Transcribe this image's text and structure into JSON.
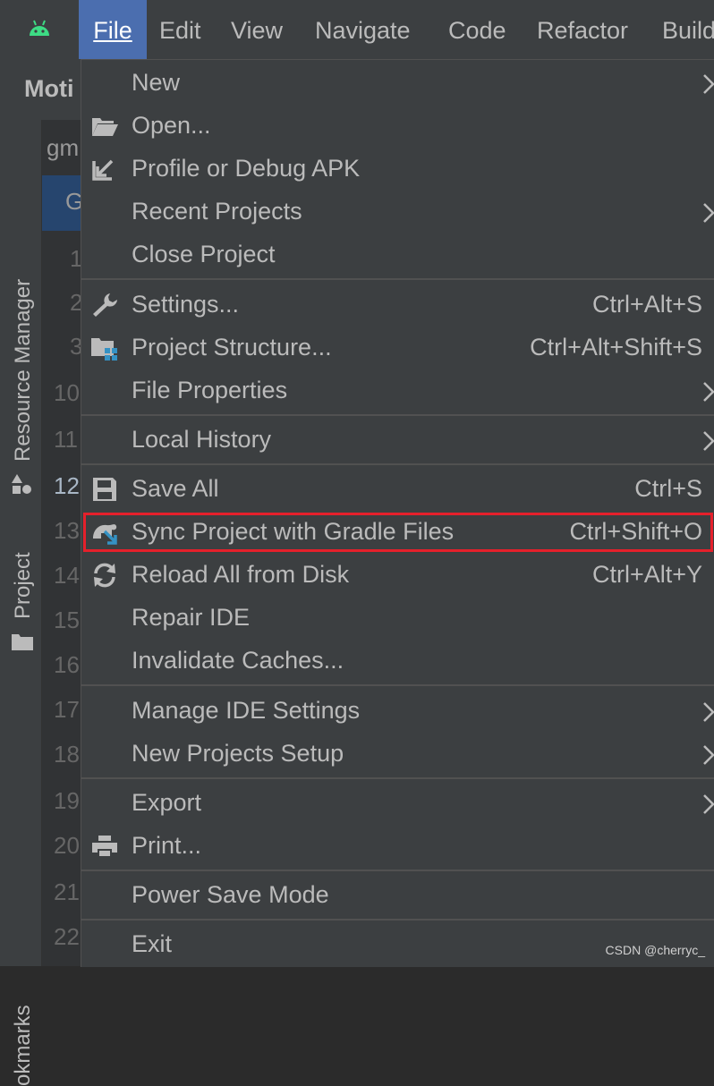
{
  "menubar": {
    "items": [
      "File",
      "Edit",
      "View",
      "Navigate",
      "Code",
      "Refactor",
      "Build"
    ]
  },
  "tool_window": {
    "title": "Moti"
  },
  "editor": {
    "tabs": [
      "gm",
      "G"
    ],
    "line_numbers": [
      "1",
      "2",
      "3",
      "10",
      "11",
      "12",
      "13",
      "14",
      "15",
      "16",
      "17",
      "18",
      "19",
      "20",
      "21",
      "22"
    ]
  },
  "side_tabs": {
    "resource_manager": "Resource Manager",
    "project": "Project",
    "bookmarks": "okmarks"
  },
  "file_menu": {
    "new": "New",
    "open": "Open...",
    "profile_debug_apk": "Profile or Debug APK",
    "recent_projects": "Recent Projects",
    "close_project": "Close Project",
    "settings": "Settings...",
    "settings_shortcut": "Ctrl+Alt+S",
    "project_structure": "Project Structure...",
    "project_structure_shortcut": "Ctrl+Alt+Shift+S",
    "file_properties": "File Properties",
    "local_history": "Local History",
    "save_all": "Save All",
    "save_all_shortcut": "Ctrl+S",
    "sync_gradle": "Sync Project with Gradle Files",
    "sync_gradle_shortcut": "Ctrl+Shift+O",
    "reload_disk": "Reload All from Disk",
    "reload_disk_shortcut": "Ctrl+Alt+Y",
    "repair_ide": "Repair IDE",
    "invalidate_caches": "Invalidate Caches...",
    "manage_ide_settings": "Manage IDE Settings",
    "new_projects_setup": "New Projects Setup",
    "export": "Export",
    "print": "Print...",
    "power_save_mode": "Power Save Mode",
    "exit": "Exit"
  },
  "watermark": "CSDN @cherryc_",
  "colors": {
    "menu_bg": "#3c3f41",
    "active_menu": "#4b6eaf",
    "highlight_border": "#e5202b",
    "android_green": "#3ddc84",
    "icon_blue": "#3592c4"
  },
  "icons": {
    "menubar": "android-icon",
    "open": "folder-open-icon",
    "profile_debug_apk": "import-arrow-icon",
    "settings": "wrench-icon",
    "project_structure": "project-structure-icon",
    "save_all": "floppy-disk-icon",
    "sync_gradle": "gradle-sync-icon",
    "reload_disk": "reload-icon",
    "print": "printer-icon"
  }
}
